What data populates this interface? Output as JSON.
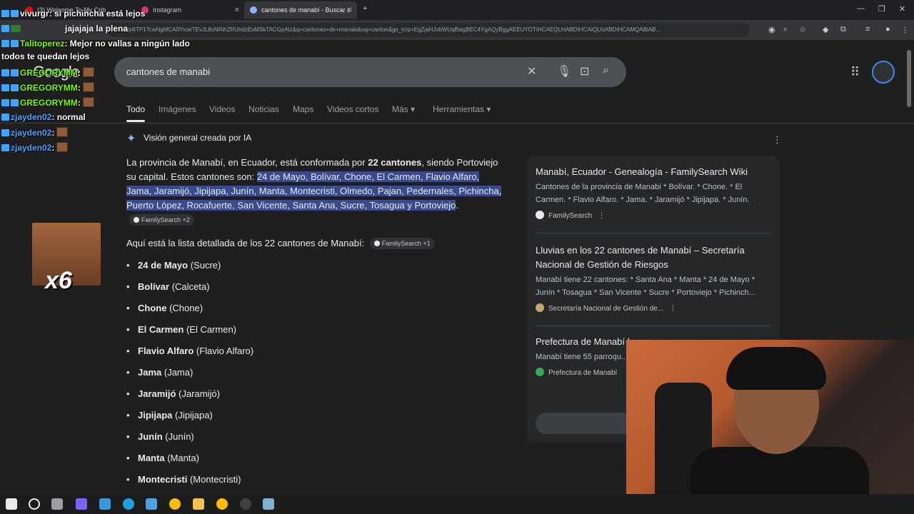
{
  "browser": {
    "tabs": [
      {
        "label": "(3) Welcome To My Crib",
        "color": "#ff0000"
      },
      {
        "label": "Instagram",
        "color": "#e1306c"
      },
      {
        "label": "cantones de manabí - Buscar c",
        "color": "#8ab4f8"
      }
    ],
    "url": "p=eJzj4tTP1TcwNgMCA0YvoeTEvJL8vNRihZRUhdzEvMSkTACGpAlz&q=cantones+de+manabi&oq=canton&gs_lcrp=EgZjaHJvbWUqBwgBEC4YgAQyBggAEEUYOTIHCAEQLhiABDIHCAIQLhiABDIHCAMQABiAB..."
  },
  "chat": [
    {
      "user": "vivurgr",
      "color": "#ffffff",
      "text": ": si pichincha está lejos"
    },
    {
      "user": "",
      "color": "#ff4040",
      "text": "jajajaja la plena"
    },
    {
      "user": "Talitoperez",
      "color": "#7cfc00",
      "text": ": Mejor no vallas a ningún lado"
    },
    {
      "user": "",
      "color": "#ffffff",
      "text": "todos te quedan lejos"
    },
    {
      "user": "GREGORYMM",
      "color": "#7cfc00",
      "text": ":"
    },
    {
      "user": "GREGORYMM",
      "color": "#7cfc00",
      "text": ":"
    },
    {
      "user": "GREGORYMM",
      "color": "#7cfc00",
      "text": ":"
    },
    {
      "user": "zjayden02",
      "color": "#4fa3ff",
      "text": ": normal"
    },
    {
      "user": "zjayden02",
      "color": "#4fa3ff",
      "text": ":"
    },
    {
      "user": "zjayden02",
      "color": "#4fa3ff",
      "text": ":"
    }
  ],
  "sticker": {
    "multiplier": "x6"
  },
  "google": {
    "logo": "Google",
    "query": "cantones de manabi",
    "tabs": [
      "Todo",
      "Imágenes",
      "Videos",
      "Noticias",
      "Maps",
      "Videos cortos",
      "Más ▾",
      "Herramientas ▾"
    ],
    "ai_header": "Visión general creada por IA",
    "intro_a": "La provincia de Manabí, en Ecuador, está conformada por ",
    "intro_bold": "22 cantones",
    "intro_b": ", siendo Portoviejo su capital. Estos cantones son: ",
    "intro_hl": "24 de Mayo, Bolívar, Chone, El Carmen, Flavio Alfaro, Jama, Jaramijó, Jipijapa, Junín, Manta, Montecristi, Olmedo, Pajan, Pedernales, Pichincha, Puerto López, Rocafuerte, San Vicente, Santa Ana, Sucre, Tosagua y Portoviejo",
    "intro_end": ".",
    "chip1": "FamilySearch +2",
    "list_intro": "Aquí está la lista detallada de los 22 cantones de Manabí:",
    "chip2": "FamilySearch +1",
    "cantones": [
      {
        "name": "24 de Mayo",
        "seat": "(Sucre)"
      },
      {
        "name": "Bolívar",
        "seat": "(Calceta)"
      },
      {
        "name": "Chone",
        "seat": "(Chone)"
      },
      {
        "name": "El Carmen",
        "seat": "(El Carmen)"
      },
      {
        "name": "Flavio Alfaro",
        "seat": "(Flavio Alfaro)"
      },
      {
        "name": "Jama",
        "seat": "(Jama)"
      },
      {
        "name": "Jaramijó",
        "seat": "(Jaramijó)"
      },
      {
        "name": "Jipijapa",
        "seat": "(Jipijapa)"
      },
      {
        "name": "Junín",
        "seat": "(Junín)"
      },
      {
        "name": "Manta",
        "seat": "(Manta)"
      },
      {
        "name": "Montecristi",
        "seat": "(Montecristi)"
      }
    ],
    "sources": [
      {
        "title": "Manabí, Ecuador - Genealogía - FamilySearch Wiki",
        "snippet": "Cantones de la provincia de Manabí * Bolívar. * Chone. * El Carmen. * Flavio Alfaro. * Jama. * Jaramijó * Jipijapa. * Junín.",
        "site": "FamilySearch"
      },
      {
        "title": "Lluvias en los 22 cantones de Manabí – Secretaría Nacional de Gestión de Riesgos",
        "snippet": "Manabí tiene 22 cantones: * Santa Ana * Manta * 24 de Mayo * Junín * Tosagua * San Vicente * Sucre * Portoviejo * Pichinch...",
        "site": "Secretaría Nacional de Gestión de..."
      },
      {
        "title": "Prefectura de Manabí | ...",
        "snippet": "Manabí tiene 55 parroqu... cantones, la Prefectura d...",
        "site": "Prefectura de Manabí"
      }
    ]
  }
}
